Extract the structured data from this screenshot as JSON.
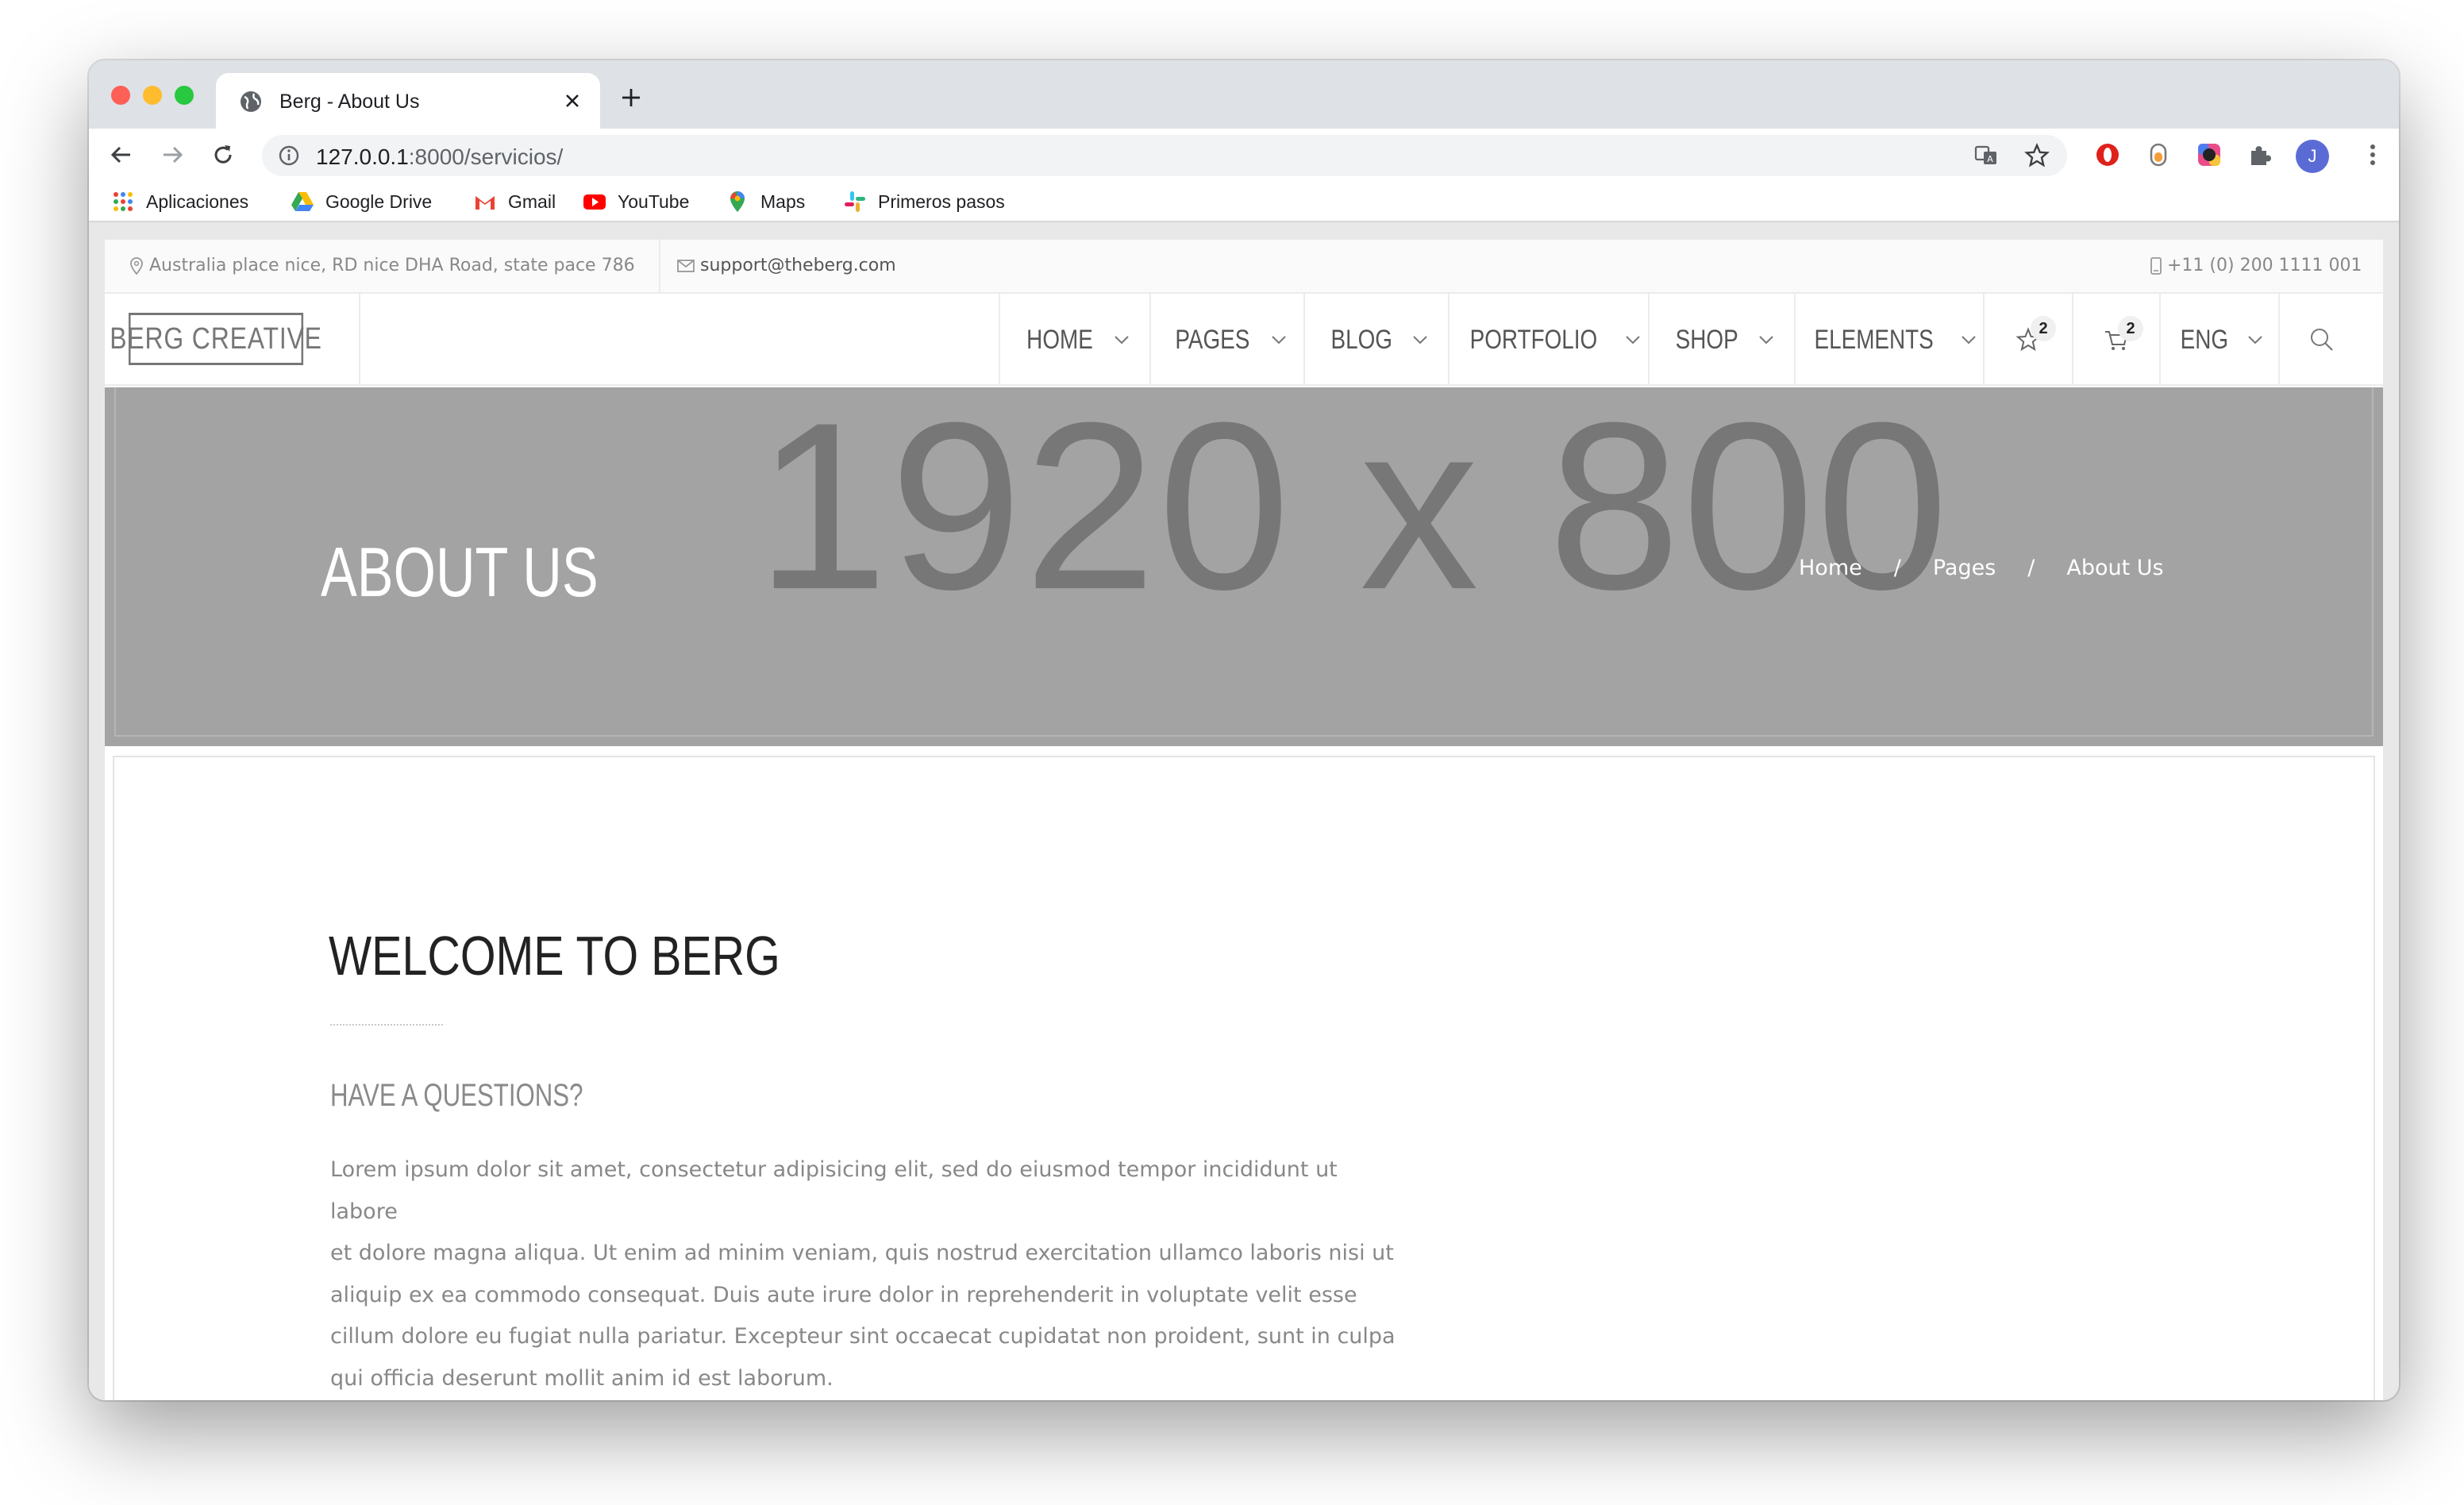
{
  "browser": {
    "tab_title": "Berg - About Us",
    "url_host": "127.0.0.1",
    "url_rest": ":8000/servicios/",
    "avatar_letter": "J",
    "bookmarks": [
      {
        "label": "Aplicaciones",
        "icon": "apps-grid-icon"
      },
      {
        "label": "Google Drive",
        "icon": "google-drive-icon"
      },
      {
        "label": "Gmail",
        "icon": "gmail-icon"
      },
      {
        "label": "YouTube",
        "icon": "youtube-icon"
      },
      {
        "label": "Maps",
        "icon": "maps-pin-icon"
      },
      {
        "label": "Primeros pasos",
        "icon": "slack-icon"
      }
    ]
  },
  "site": {
    "topbar": {
      "address": "Australia place nice, RD nice DHA Road, state pace 786",
      "email": "support@theberg.com",
      "phone": "+11 (0) 200 1111 001"
    },
    "logo": "BERG CREATIVE",
    "menu": [
      "HOME",
      "PAGES",
      "BLOG",
      "PORTFOLIO",
      "SHOP",
      "ELEMENTS"
    ],
    "wishlist_count": "2",
    "cart_count": "2",
    "language": "ENG",
    "hero": {
      "placeholder": "1920 x 800",
      "title": "ABOUT US",
      "breadcrumb": [
        "Home",
        "/",
        "Pages",
        "/",
        "About Us"
      ]
    },
    "content": {
      "heading": "WELCOME TO BERG",
      "subheading": "HAVE A QUESTIONS?",
      "paragraph_lines": [
        "Lorem ipsum dolor sit amet, consectetur adipisicing elit, sed do eiusmod tempor incididunt ut labore",
        "et dolore magna aliqua. Ut enim ad minim veniam, quis nostrud exercitation ullamco laboris nisi ut",
        "aliquip ex ea commodo consequat. Duis aute irure dolor in reprehenderit in voluptate velit esse",
        "cillum dolore eu fugiat nulla pariatur. Excepteur sint occaecat cupidatat non proident, sunt in culpa",
        "qui officia deserunt mollit anim id est laborum."
      ]
    }
  },
  "colors": {
    "hero_bg": "#a3a3a3",
    "placeholder_text": "#777777",
    "menu_text": "#555555",
    "body_text": "#888888"
  }
}
